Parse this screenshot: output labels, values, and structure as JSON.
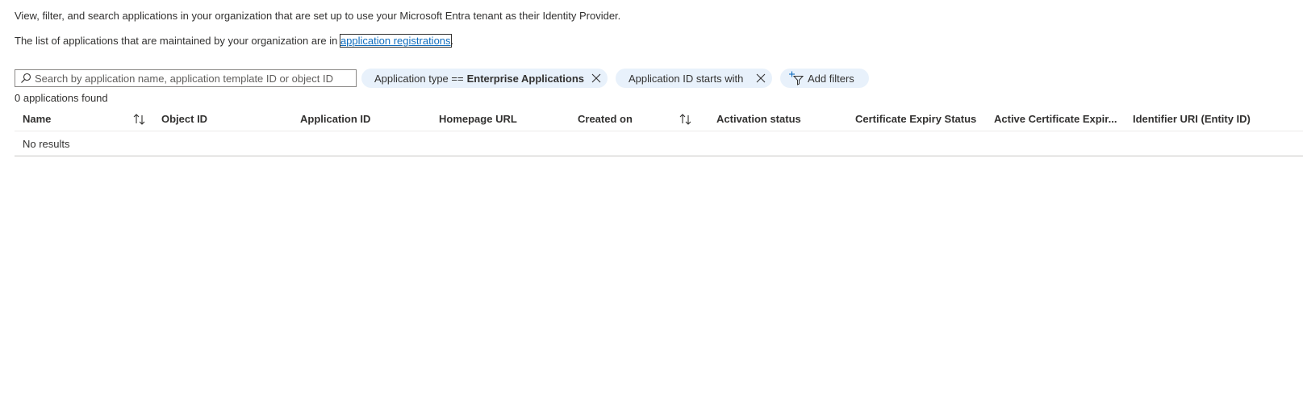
{
  "description": {
    "line1": "View, filter, and search applications in your organization that are set up to use your Microsoft Entra tenant as their Identity Provider.",
    "line2_prefix": "The list of applications that are maintained by your organization are in ",
    "line2_link": "application registrations",
    "line2_suffix": "."
  },
  "search": {
    "placeholder": "Search by application name, application template ID or object ID",
    "value": "",
    "icon": "search-icon"
  },
  "filters": [
    {
      "label": "Application type ==",
      "value": "Enterprise Applications",
      "icon": "close-icon"
    },
    {
      "label": "Application ID starts with",
      "value": "",
      "icon": "close-icon"
    }
  ],
  "add_filters": {
    "label": "Add filters",
    "icon": "add-filter-icon"
  },
  "results_count": "0 applications found",
  "table": {
    "columns": [
      {
        "label": "Name",
        "sortable": true
      },
      {
        "label": "Object ID",
        "sortable": false
      },
      {
        "label": "Application ID",
        "sortable": false
      },
      {
        "label": "Homepage URL",
        "sortable": false
      },
      {
        "label": "Created on",
        "sortable": true
      },
      {
        "label": "Activation status",
        "sortable": false
      },
      {
        "label": "Certificate Expiry Status",
        "sortable": false
      },
      {
        "label": "Active Certificate Expir...",
        "sortable": false
      },
      {
        "label": "Identifier URI (Entity ID)",
        "sortable": false
      }
    ],
    "empty_message": "No results"
  },
  "colors": {
    "link": "#0f6cbd",
    "pill_background": "#e8f1fb",
    "text": "#323130"
  }
}
